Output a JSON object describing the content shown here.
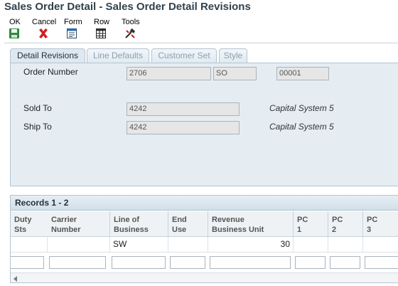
{
  "window": {
    "title": "Sales Order Detail - Sales Order Detail Revisions"
  },
  "toolbar": {
    "ok": "OK",
    "cancel": "Cancel",
    "form": "Form",
    "row": "Row",
    "tools": "Tools"
  },
  "tabs": [
    "Detail Revisions",
    "Line Defaults",
    "Customer Set",
    "Style"
  ],
  "header_form": {
    "order_number_label": "Order Number",
    "order_number": "2706",
    "order_type": "SO",
    "order_company": "00001",
    "sold_to_label": "Sold To",
    "sold_to": "4242",
    "sold_to_name": "Capital System 5",
    "ship_to_label": "Ship To",
    "ship_to": "4242",
    "ship_to_name": "Capital System 5"
  },
  "grid": {
    "title": "Records 1 - 2",
    "columns": [
      {
        "line1": "Duty",
        "line2": "Sts"
      },
      {
        "line1": "Carrier",
        "line2": "Number"
      },
      {
        "line1": "Line of",
        "line2": "Business"
      },
      {
        "line1": "End",
        "line2": "Use"
      },
      {
        "line1": "Revenue",
        "line2": "Business Unit"
      },
      {
        "line1": "PC",
        "line2": "1"
      },
      {
        "line1": "PC",
        "line2": "2"
      },
      {
        "line1": "PC",
        "line2": "3"
      }
    ],
    "rows": [
      {
        "line_of_business": "SW",
        "revenue_business_unit": "30"
      }
    ]
  },
  "colors": {
    "title": "#31424e",
    "panel_bg": "#e5edf3",
    "tab_border": "#b3c4d2",
    "cancel_icon": "#d11f1f",
    "ok_icon": "#2e8b3e"
  }
}
